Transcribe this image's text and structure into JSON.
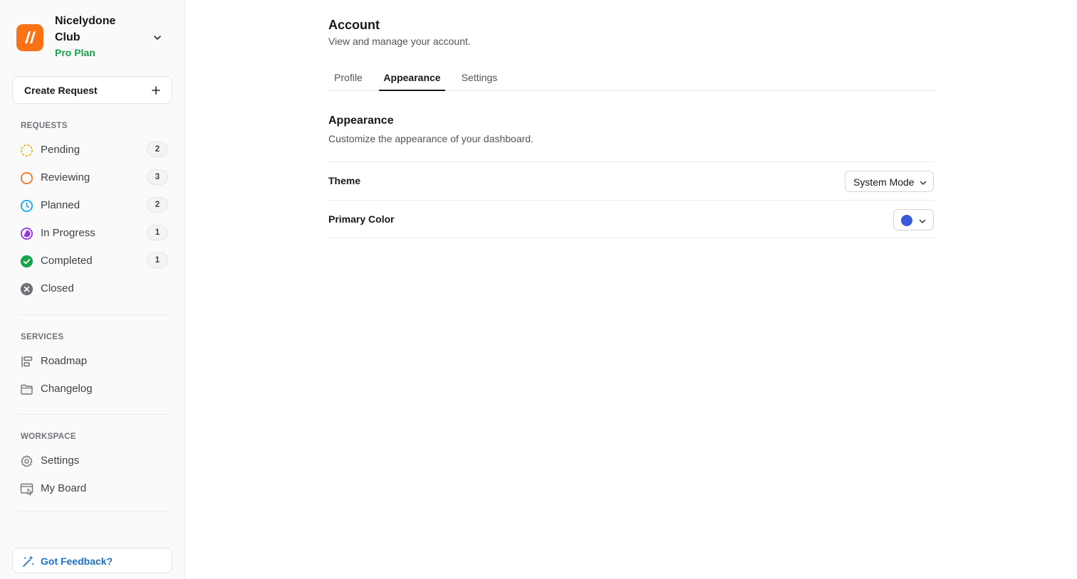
{
  "workspace": {
    "name": "Nicelydone Club",
    "plan": "Pro Plan"
  },
  "sidebar": {
    "create_label": "Create Request",
    "requests_title": "REQUESTS",
    "requests": [
      {
        "label": "Pending",
        "count": "2",
        "icon": "pending-dashed-circle-icon",
        "color": "#eab308"
      },
      {
        "label": "Reviewing",
        "count": "3",
        "icon": "reviewing-circle-icon",
        "color": "#f97316"
      },
      {
        "label": "Planned",
        "count": "2",
        "icon": "clock-icon",
        "color": "#0ea5e9"
      },
      {
        "label": "In Progress",
        "count": "1",
        "icon": "half-circle-icon",
        "color": "#9333ea"
      },
      {
        "label": "Completed",
        "count": "1",
        "icon": "check-circle-icon",
        "color": "#16a34a"
      },
      {
        "label": "Closed",
        "icon": "x-circle-icon",
        "color": "#71717a"
      }
    ],
    "services_title": "SERVICES",
    "services": [
      {
        "label": "Roadmap",
        "icon": "roadmap-icon"
      },
      {
        "label": "Changelog",
        "icon": "folder-icon"
      }
    ],
    "workspace_title": "WORKSPACE",
    "workspace_items": [
      {
        "label": "Settings",
        "icon": "gear-icon"
      },
      {
        "label": "My Board",
        "icon": "board-icon"
      }
    ],
    "feedback_label": "Got Feedback?"
  },
  "main": {
    "title": "Account",
    "subtitle": "View and manage your account.",
    "tabs": [
      {
        "label": "Profile",
        "active": false
      },
      {
        "label": "Appearance",
        "active": true
      },
      {
        "label": "Settings",
        "active": false
      }
    ],
    "section": {
      "title": "Appearance",
      "description": "Customize the appearance of your dashboard."
    },
    "theme": {
      "label": "Theme",
      "value": "System Mode"
    },
    "primary_color": {
      "label": "Primary Color",
      "value": "#3b5bdb"
    }
  },
  "colors": {
    "brand": "#f97316",
    "plan": "#16a34a",
    "feedback": "#1d6fc9"
  }
}
